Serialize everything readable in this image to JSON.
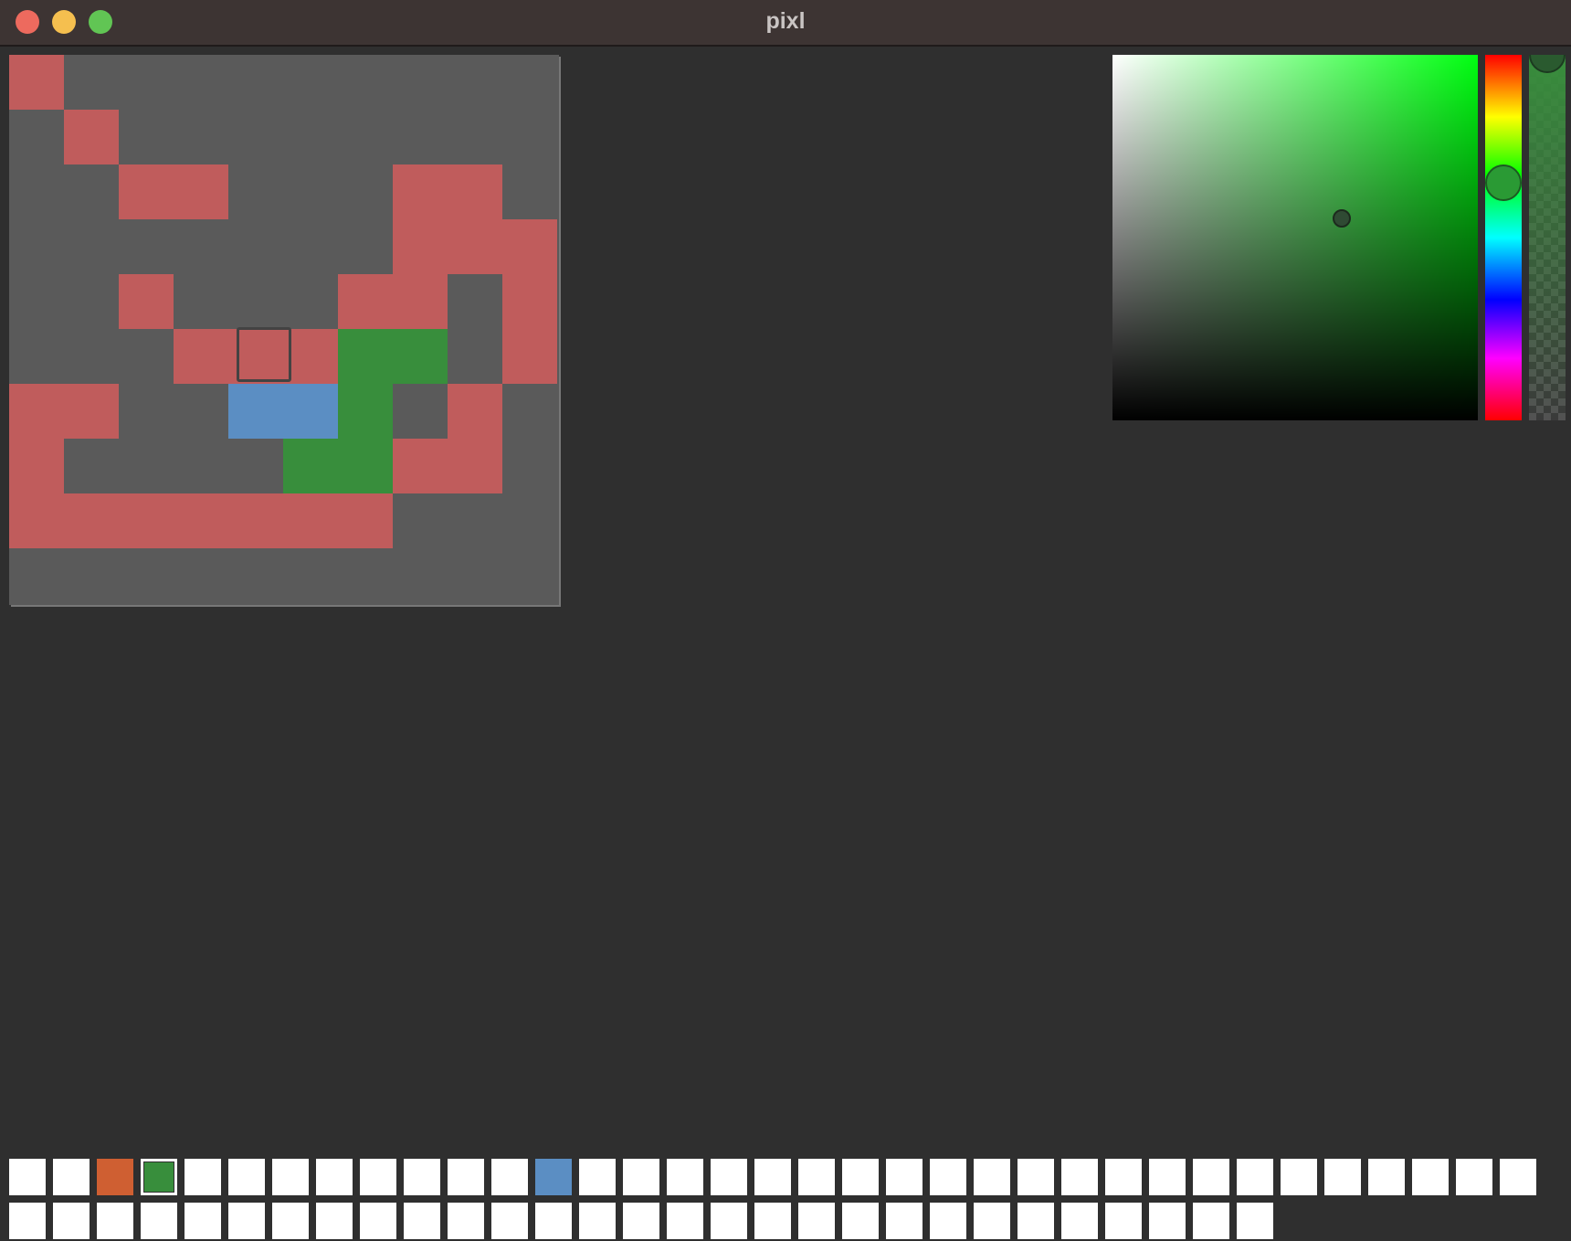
{
  "window": {
    "title": "pixl"
  },
  "colors": {
    "canvas_bg": "#5a5a5a",
    "red": "#c05c5c",
    "green": "#388e3c",
    "blue": "#5b8ec3",
    "orange": "#cf5f32",
    "white": "#ffffff"
  },
  "canvas": {
    "grid_cols": 10,
    "grid_rows": 10,
    "cells": [
      {
        "col": 0,
        "row": 0,
        "color": "red"
      },
      {
        "col": 1,
        "row": 1,
        "color": "red"
      },
      {
        "col": 2,
        "row": 2,
        "color": "red"
      },
      {
        "col": 3,
        "row": 2,
        "color": "red"
      },
      {
        "col": 7,
        "row": 2,
        "color": "red"
      },
      {
        "col": 8,
        "row": 2,
        "color": "red"
      },
      {
        "col": 7,
        "row": 3,
        "color": "red"
      },
      {
        "col": 8,
        "row": 3,
        "color": "red"
      },
      {
        "col": 9,
        "row": 3,
        "color": "red"
      },
      {
        "col": 2,
        "row": 4,
        "color": "red"
      },
      {
        "col": 6,
        "row": 4,
        "color": "red"
      },
      {
        "col": 7,
        "row": 4,
        "color": "red"
      },
      {
        "col": 9,
        "row": 4,
        "color": "red"
      },
      {
        "col": 3,
        "row": 5,
        "color": "red"
      },
      {
        "col": 4,
        "row": 5,
        "color": "red"
      },
      {
        "col": 5,
        "row": 5,
        "color": "red"
      },
      {
        "col": 6,
        "row": 5,
        "color": "green"
      },
      {
        "col": 7,
        "row": 5,
        "color": "green"
      },
      {
        "col": 9,
        "row": 5,
        "color": "red"
      },
      {
        "col": 0,
        "row": 6,
        "color": "red"
      },
      {
        "col": 1,
        "row": 6,
        "color": "red"
      },
      {
        "col": 4,
        "row": 6,
        "color": "blue"
      },
      {
        "col": 5,
        "row": 6,
        "color": "blue"
      },
      {
        "col": 6,
        "row": 6,
        "color": "green"
      },
      {
        "col": 8,
        "row": 6,
        "color": "red"
      },
      {
        "col": 0,
        "row": 7,
        "color": "red"
      },
      {
        "col": 5,
        "row": 7,
        "color": "green"
      },
      {
        "col": 6,
        "row": 7,
        "color": "green"
      },
      {
        "col": 7,
        "row": 7,
        "color": "red"
      },
      {
        "col": 8,
        "row": 7,
        "color": "red"
      },
      {
        "col": 0,
        "row": 8,
        "color": "red"
      },
      {
        "col": 1,
        "row": 8,
        "color": "red"
      },
      {
        "col": 2,
        "row": 8,
        "color": "red"
      },
      {
        "col": 3,
        "row": 8,
        "color": "red"
      },
      {
        "col": 4,
        "row": 8,
        "color": "red"
      },
      {
        "col": 5,
        "row": 8,
        "color": "red"
      },
      {
        "col": 6,
        "row": 8,
        "color": "red"
      }
    ],
    "hover_cell": {
      "col": 4,
      "row": 4
    }
  },
  "color_picker": {
    "current_color": "#388e3c",
    "hue": 125,
    "saturation": 0.6,
    "value": 0.55,
    "alpha": 1.0
  },
  "palette": {
    "selected_index": 3,
    "row1": [
      "#ffffff",
      "#ffffff",
      "#cf5f32",
      "#388e3c",
      "#ffffff",
      "#ffffff",
      "#ffffff",
      "#ffffff",
      "#ffffff",
      "#ffffff",
      "#ffffff",
      "#ffffff",
      "#5b8ec3",
      "#ffffff",
      "#ffffff",
      "#ffffff",
      "#ffffff",
      "#ffffff",
      "#ffffff",
      "#ffffff",
      "#ffffff",
      "#ffffff",
      "#ffffff",
      "#ffffff",
      "#ffffff",
      "#ffffff",
      "#ffffff",
      "#ffffff",
      "#ffffff",
      "#ffffff",
      "#ffffff",
      "#ffffff",
      "#ffffff",
      "#ffffff",
      "#ffffff"
    ],
    "row2": [
      "#ffffff",
      "#ffffff",
      "#ffffff",
      "#ffffff",
      "#ffffff",
      "#ffffff",
      "#ffffff",
      "#ffffff",
      "#ffffff",
      "#ffffff",
      "#ffffff",
      "#ffffff",
      "#ffffff",
      "#ffffff",
      "#ffffff",
      "#ffffff",
      "#ffffff",
      "#ffffff",
      "#ffffff",
      "#ffffff",
      "#ffffff",
      "#ffffff",
      "#ffffff",
      "#ffffff",
      "#ffffff",
      "#ffffff",
      "#ffffff",
      "#ffffff",
      "#ffffff"
    ]
  }
}
